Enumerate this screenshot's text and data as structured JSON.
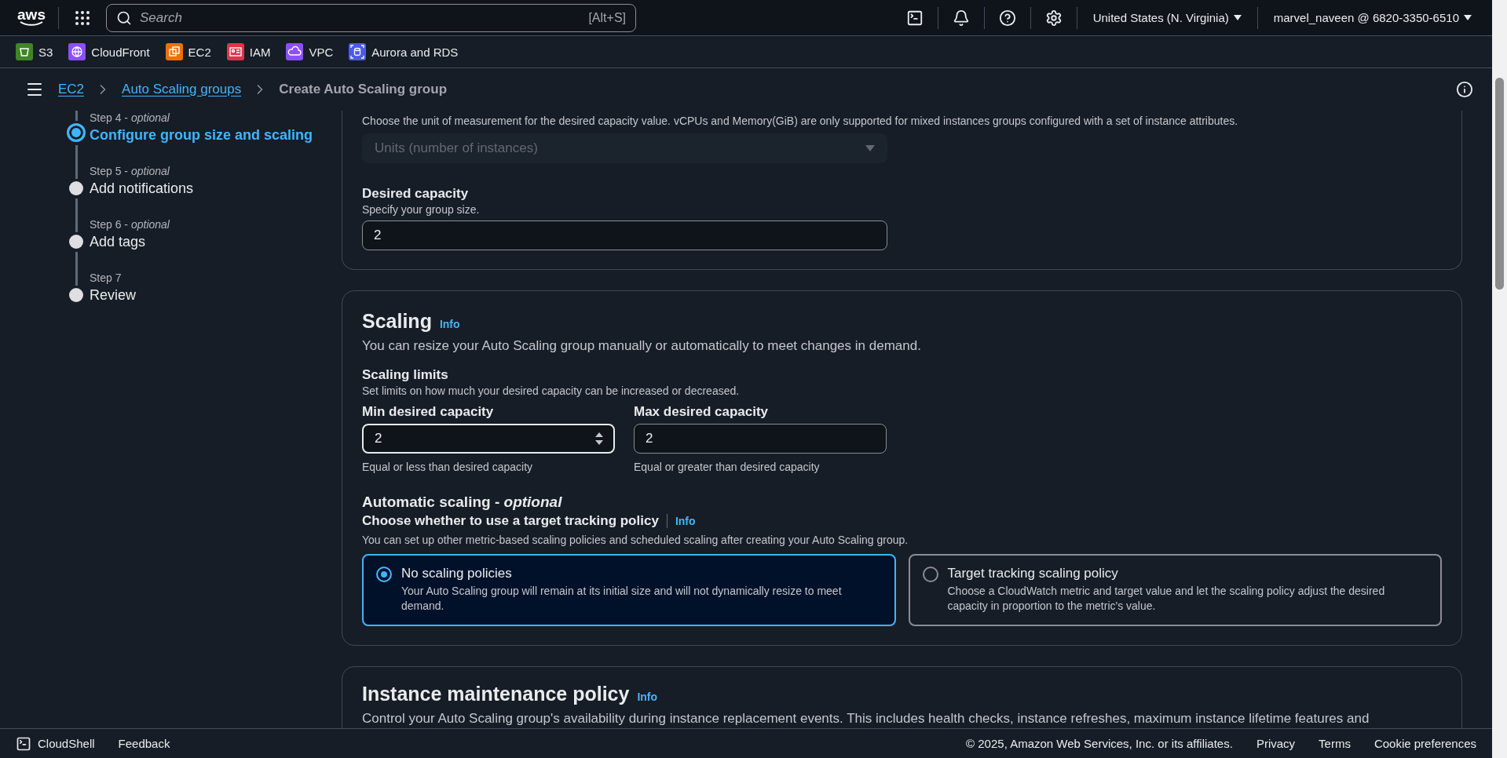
{
  "top_nav": {
    "logo": "aws",
    "search": {
      "placeholder": "Search",
      "shortcut": "[Alt+S]"
    },
    "region": "United States (N. Virginia)",
    "account": "marvel_naveen @ 6820-3350-6510"
  },
  "favorites": [
    {
      "label": "S3",
      "color": "#3f8624",
      "kind": "bucket"
    },
    {
      "label": "CloudFront",
      "color": "#8c4fff",
      "kind": "globe"
    },
    {
      "label": "EC2",
      "color": "#ed7100",
      "kind": "chip"
    },
    {
      "label": "IAM",
      "color": "#dd344c",
      "kind": "badge"
    },
    {
      "label": "VPC",
      "color": "#8c4fff",
      "kind": "cloud"
    },
    {
      "label": "Aurora and RDS",
      "color": "#4d5ae6",
      "kind": "database"
    }
  ],
  "breadcrumbs": [
    {
      "label": "EC2",
      "link": true
    },
    {
      "label": "Auto Scaling groups",
      "link": true
    },
    {
      "label": "Create Auto Scaling group",
      "link": false
    }
  ],
  "steps": [
    {
      "label": "Step 4 - *optional*",
      "title": "Configure group size and scaling",
      "selected": true
    },
    {
      "label": "Step 5 - *optional*",
      "title": "Add notifications",
      "selected": false
    },
    {
      "label": "Step 6 - *optional*",
      "title": "Add tags",
      "selected": false
    },
    {
      "label": "Step 7",
      "title": "Review",
      "selected": false
    }
  ],
  "capacity": {
    "unit_hint": "Choose the unit of measurement for the desired capacity value. vCPUs and Memory(GiB) are only supported for mixed instances groups configured with a set of instance attributes.",
    "unit_select": {
      "value": "Units (number of instances)",
      "disabled": true
    },
    "desired": {
      "label": "Desired capacity",
      "hint": "Specify your group size.",
      "value": "2"
    }
  },
  "scaling": {
    "title": "Scaling",
    "info": "Info",
    "description": "You can resize your Auto Scaling group manually or automatically to meet changes in demand.",
    "limits_label": "Scaling limits",
    "limits_hint": "Set limits on how much your desired capacity can be increased or decreased.",
    "limits": [
      {
        "label": "Min desired capacity",
        "value": "2",
        "hint": "Equal or less than desired capacity",
        "focused": true
      },
      {
        "label": "Max desired capacity",
        "value": "2",
        "hint": "Equal or greater than desired capacity",
        "focused": false
      }
    ],
    "auto_title": "Automatic scaling - *optional*",
    "policy_label": "Choose whether to use a target tracking policy",
    "policy_info": "Info",
    "policy_hint": "You can set up other metric-based scaling policies and scheduled scaling after creating your Auto Scaling group.",
    "options": [
      {
        "title": "No scaling policies",
        "description": "Your Auto Scaling group will remain at its initial size and will not dynamically resize to meet demand.",
        "selected": true
      },
      {
        "title": "Target tracking scaling policy",
        "description": "Choose a CloudWatch metric and target value and let the scaling policy adjust the desired capacity in proportion to the metric's value.",
        "selected": false
      }
    ]
  },
  "maintenance": {
    "title": "Instance maintenance policy",
    "info": "Info",
    "description": "Control your Auto Scaling group's availability during instance replacement events. This includes health checks, instance refreshes, maximum instance lifetime features and"
  },
  "footer": {
    "cloudshell": "CloudShell",
    "feedback": "Feedback",
    "copyright": "© 2025, Amazon Web Services, Inc. or its affiliates.",
    "links": [
      "Privacy",
      "Terms",
      "Cookie preferences"
    ]
  }
}
